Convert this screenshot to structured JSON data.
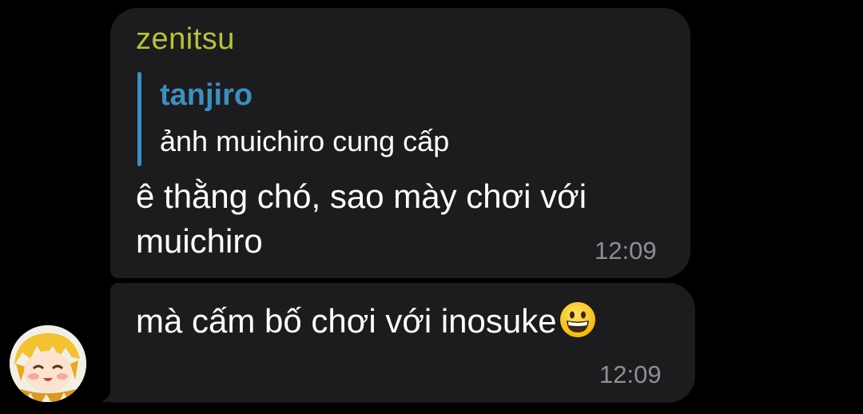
{
  "messages": [
    {
      "sender": "zenitsu",
      "reply": {
        "name": "tanjiro",
        "text": "ảnh muichiro cung cấp"
      },
      "text": "ê thằng chó, sao mày chơi với muichiro",
      "time": "12:09"
    },
    {
      "text": "mà cấm bố chơi với inosuke",
      "emoji": "grinning-face-emoji",
      "time": "12:09"
    }
  ],
  "colors": {
    "background": "#000000",
    "bubble": "#1c1c1e",
    "sender_name": "#b5c23a",
    "reply_accent": "#3d8fbf",
    "timestamp": "#8e8e93"
  },
  "avatar": {
    "icon": "zenitsu-avatar"
  }
}
